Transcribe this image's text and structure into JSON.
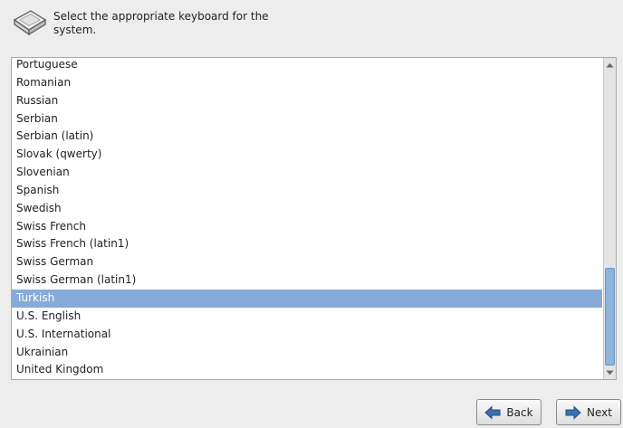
{
  "header": {
    "text": "Select the appropriate keyboard for the system.",
    "icon": "keyboard-icon"
  },
  "keyboard_list": {
    "items": [
      "Portuguese",
      "Romanian",
      "Russian",
      "Serbian",
      "Serbian (latin)",
      "Slovak (qwerty)",
      "Slovenian",
      "Spanish",
      "Swedish",
      "Swiss French",
      "Swiss French (latin1)",
      "Swiss German",
      "Swiss German (latin1)",
      "Turkish",
      "U.S. English",
      "U.S. International",
      "Ukrainian",
      "United Kingdom"
    ],
    "selected": "Turkish"
  },
  "buttons": {
    "back_label": "Back",
    "next_label": "Next"
  },
  "colors": {
    "selection": "#86abd9",
    "arrow_blue": "#3a6fb0"
  }
}
